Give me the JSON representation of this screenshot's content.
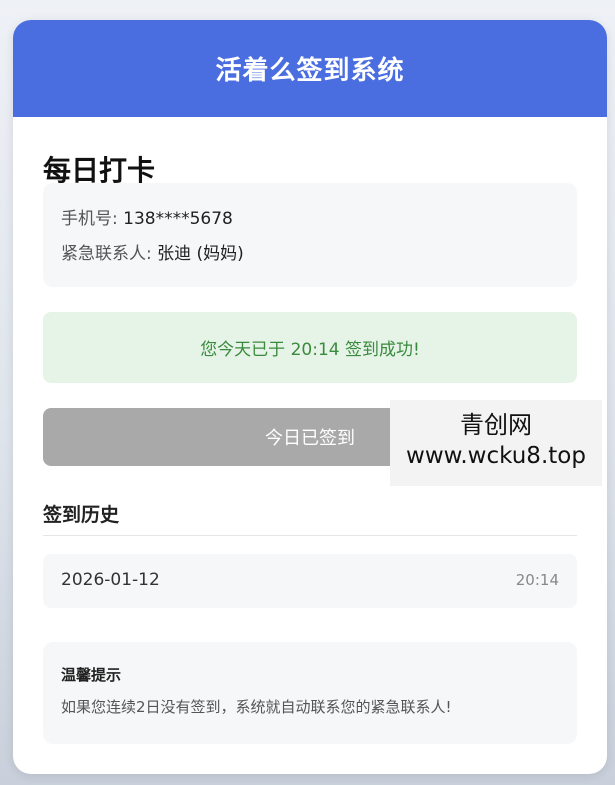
{
  "header": {
    "title": "活着么签到系统"
  },
  "checkin": {
    "section_title": "每日打卡",
    "phone_label": "手机号:",
    "phone_value": "138****5678",
    "contact_label": "紧急联系人:",
    "contact_value": "张迪 (妈妈)",
    "success_message": "您今天已于 20:14 签到成功!",
    "button_label": "今日已签到"
  },
  "watermark": {
    "name": "青创网",
    "url": "www.wcku8.top"
  },
  "history": {
    "title": "签到历史",
    "entries": [
      {
        "date": "2026-01-12",
        "time": "20:14"
      }
    ]
  },
  "tips": {
    "title": "温馨提示",
    "text": "如果您连续2日没有签到，系统就自动联系您的紧急联系人!"
  },
  "colors": {
    "header_bg": "#4a6de0",
    "success_bg": "#e6f4e8",
    "success_text": "#3a8a3d",
    "button_disabled": "#a9a9a9"
  }
}
